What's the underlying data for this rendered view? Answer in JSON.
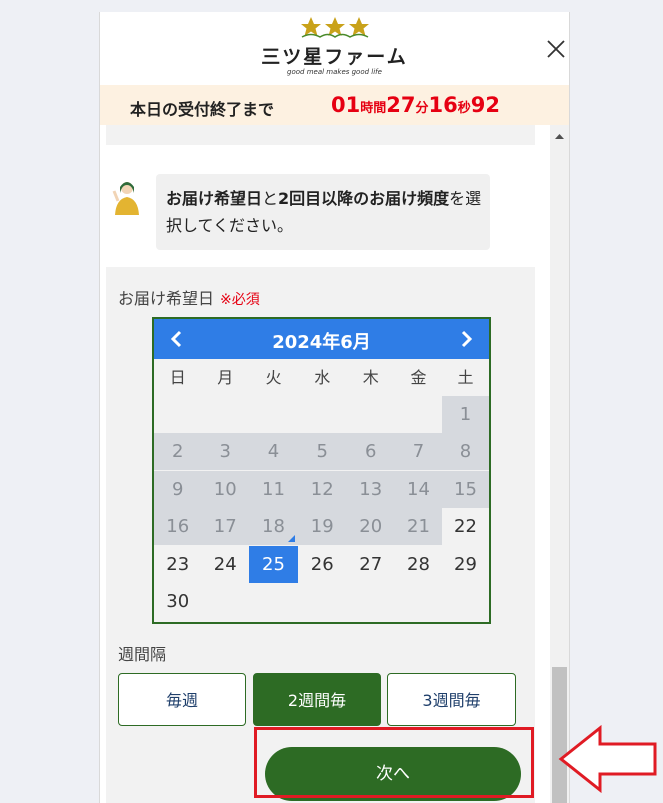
{
  "header": {
    "brand_name": "三ツ星ファーム",
    "tagline": "good meal makes good life",
    "icons": {
      "stars": "three-stars-logo-icon",
      "close": "close-icon"
    }
  },
  "timer": {
    "label": "本日の受付終了まで",
    "hours": "01",
    "hours_unit": "時間",
    "minutes": "27",
    "minutes_unit": "分",
    "seconds": "16",
    "seconds_unit": "秒",
    "fraction": "92"
  },
  "assistant": {
    "message_bold_1": "お届け希望日",
    "message_text_1": "と",
    "message_bold_2": "2回目以降のお届け頻度",
    "message_text_2": "を選択してください。"
  },
  "delivery_date": {
    "label": "お届け希望日",
    "required": "※必須",
    "calendar": {
      "month_title": "2024年6月",
      "weekdays": [
        "日",
        "月",
        "火",
        "水",
        "木",
        "金",
        "土"
      ],
      "days": [
        {
          "d": "1",
          "state": "disabled"
        },
        {
          "d": "2",
          "state": "disabled"
        },
        {
          "d": "3",
          "state": "disabled"
        },
        {
          "d": "4",
          "state": "disabled"
        },
        {
          "d": "5",
          "state": "disabled"
        },
        {
          "d": "6",
          "state": "disabled"
        },
        {
          "d": "7",
          "state": "disabled"
        },
        {
          "d": "8",
          "state": "disabled"
        },
        {
          "d": "9",
          "state": "disabled"
        },
        {
          "d": "10",
          "state": "disabled"
        },
        {
          "d": "11",
          "state": "disabled"
        },
        {
          "d": "12",
          "state": "disabled"
        },
        {
          "d": "13",
          "state": "disabled"
        },
        {
          "d": "14",
          "state": "disabled"
        },
        {
          "d": "15",
          "state": "disabled"
        },
        {
          "d": "16",
          "state": "disabled"
        },
        {
          "d": "17",
          "state": "disabled"
        },
        {
          "d": "18",
          "state": "today"
        },
        {
          "d": "19",
          "state": "disabled"
        },
        {
          "d": "20",
          "state": "disabled"
        },
        {
          "d": "21",
          "state": "disabled"
        },
        {
          "d": "22",
          "state": "available"
        },
        {
          "d": "23",
          "state": "available"
        },
        {
          "d": "24",
          "state": "available"
        },
        {
          "d": "25",
          "state": "selected"
        },
        {
          "d": "26",
          "state": "available"
        },
        {
          "d": "27",
          "state": "available"
        },
        {
          "d": "28",
          "state": "available"
        },
        {
          "d": "29",
          "state": "available"
        },
        {
          "d": "30",
          "state": "available"
        }
      ],
      "first_weekday_index": 6,
      "colors": {
        "header": "#2f7de6",
        "selected": "#2f7de6",
        "disabled": "#d6d9de",
        "border": "#2d6b24"
      }
    }
  },
  "interval": {
    "label": "週間隔",
    "options": [
      {
        "label": "毎週",
        "selected": false
      },
      {
        "label": "2週間毎",
        "selected": true
      },
      {
        "label": "3週間毎",
        "selected": false
      }
    ]
  },
  "next_button": {
    "label": "次へ"
  },
  "annotation": {
    "color": "#e01b24",
    "arrow_icon": "left-arrow-annotation-icon"
  },
  "colors": {
    "brand_green": "#2d6b24",
    "timer_red": "#e60012",
    "timer_bg": "#fdf1e1"
  }
}
